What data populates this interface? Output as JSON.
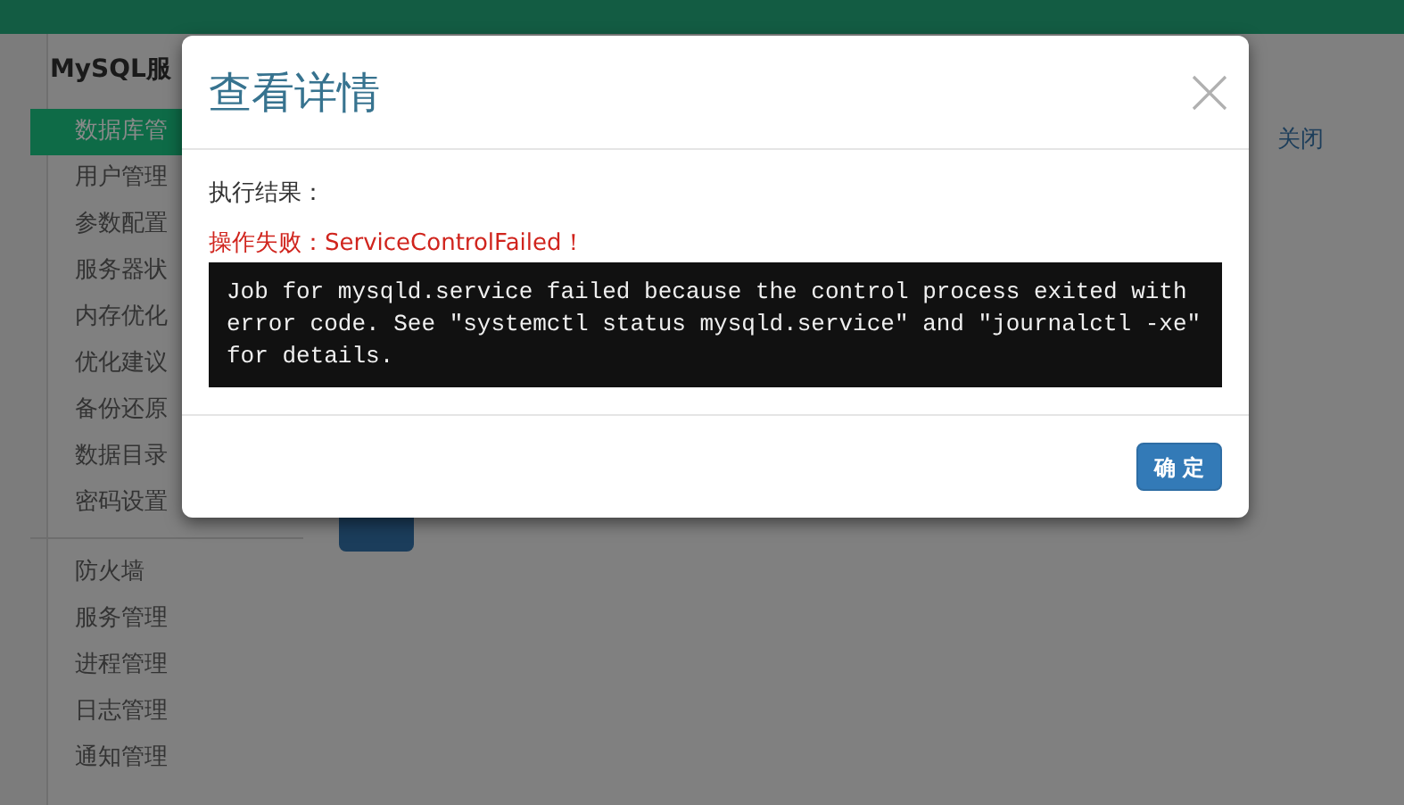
{
  "sidebar": {
    "title": "MySQL服",
    "groups": [
      {
        "items": [
          {
            "label": "数据库管",
            "selected": true
          },
          {
            "label": "用户管理",
            "selected": false
          },
          {
            "label": "参数配置",
            "selected": false
          },
          {
            "label": "服务器状",
            "selected": false
          },
          {
            "label": "内存优化",
            "selected": false
          },
          {
            "label": "优化建议",
            "selected": false
          },
          {
            "label": "备份还原",
            "selected": false
          },
          {
            "label": "数据目录",
            "selected": false
          },
          {
            "label": "密码设置",
            "selected": false
          }
        ]
      },
      {
        "items": [
          {
            "label": "防火墙",
            "selected": false
          },
          {
            "label": "服务管理",
            "selected": false
          },
          {
            "label": "进程管理",
            "selected": false
          },
          {
            "label": "日志管理",
            "selected": false
          },
          {
            "label": "通知管理",
            "selected": false
          }
        ]
      }
    ]
  },
  "main": {
    "link": "关闭"
  },
  "modal": {
    "title": "查看详情",
    "result_label": "执行结果：",
    "error": "操作失败：ServiceControlFailed！",
    "output": "Job for mysqld.service failed because the control process exited with error code. See \"systemctl status mysqld.service\" and \"journalctl -xe\" for details.",
    "buttons": [
      "确 定"
    ]
  }
}
